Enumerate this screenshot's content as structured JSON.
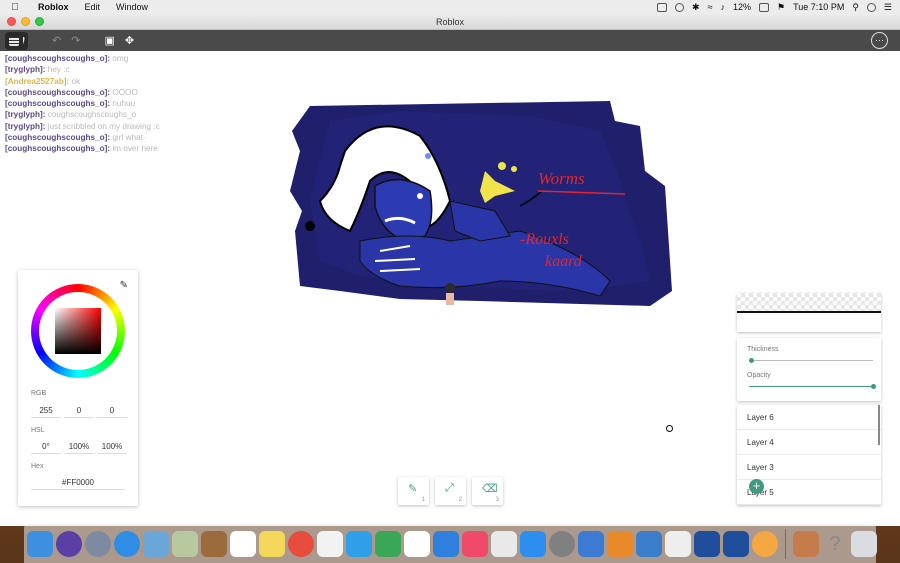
{
  "menubar": {
    "app_name": "Roblox",
    "menus": [
      "Edit",
      "Window"
    ],
    "battery": "12%",
    "clock": "Tue 7:10 PM"
  },
  "window": {
    "title": "Roblox"
  },
  "chat": [
    {
      "who": "[coughscoughscoughs_o]:",
      "msg": "omg",
      "gold": false
    },
    {
      "who": "[tryglyph]:",
      "msg": "hey :c",
      "gold": false
    },
    {
      "who": "[Andrea2527ab]:",
      "msg": "ok",
      "gold": true
    },
    {
      "who": "[coughscoughscoughs_o]:",
      "msg": "OOOO",
      "gold": false
    },
    {
      "who": "[coughscoughscoughs_o]:",
      "msg": "nuhuu",
      "gold": false
    },
    {
      "who": "[tryglyph]:",
      "msg": "coughscoughscoughs_o",
      "gold": false
    },
    {
      "who": "[tryglyph]:",
      "msg": "just scribbled on my drawing :c",
      "gold": false
    },
    {
      "who": "[coughscoughscoughs_o]:",
      "msg": "girl what-",
      "gold": false
    },
    {
      "who": "[coughscoughscoughs_o]:",
      "msg": "im over here",
      "gold": false
    }
  ],
  "drawing": {
    "text1": "Worms",
    "text2": "-Rouxls",
    "text3": "kaard"
  },
  "color_picker": {
    "rgb_label": "RGB",
    "r": "255",
    "g": "0",
    "b": "0",
    "hsl_label": "HSL",
    "h": "0°",
    "s": "100%",
    "l": "100%",
    "hex_label": "Hex",
    "hex": "#FF0000",
    "current_color": "#FF0000"
  },
  "brush": {
    "thickness_label": "Thickness",
    "thickness_value": 0.02,
    "opacity_label": "Opacity",
    "opacity_value": 1.0,
    "accent": "#3f9a7e"
  },
  "layers": [
    "Layer 6",
    "Layer 4",
    "Layer 3",
    "Layer 5"
  ],
  "tools": [
    {
      "icon": "pencil-icon",
      "num": "1"
    },
    {
      "icon": "line-icon",
      "num": "2"
    },
    {
      "icon": "eraser-icon",
      "num": "3"
    }
  ]
}
